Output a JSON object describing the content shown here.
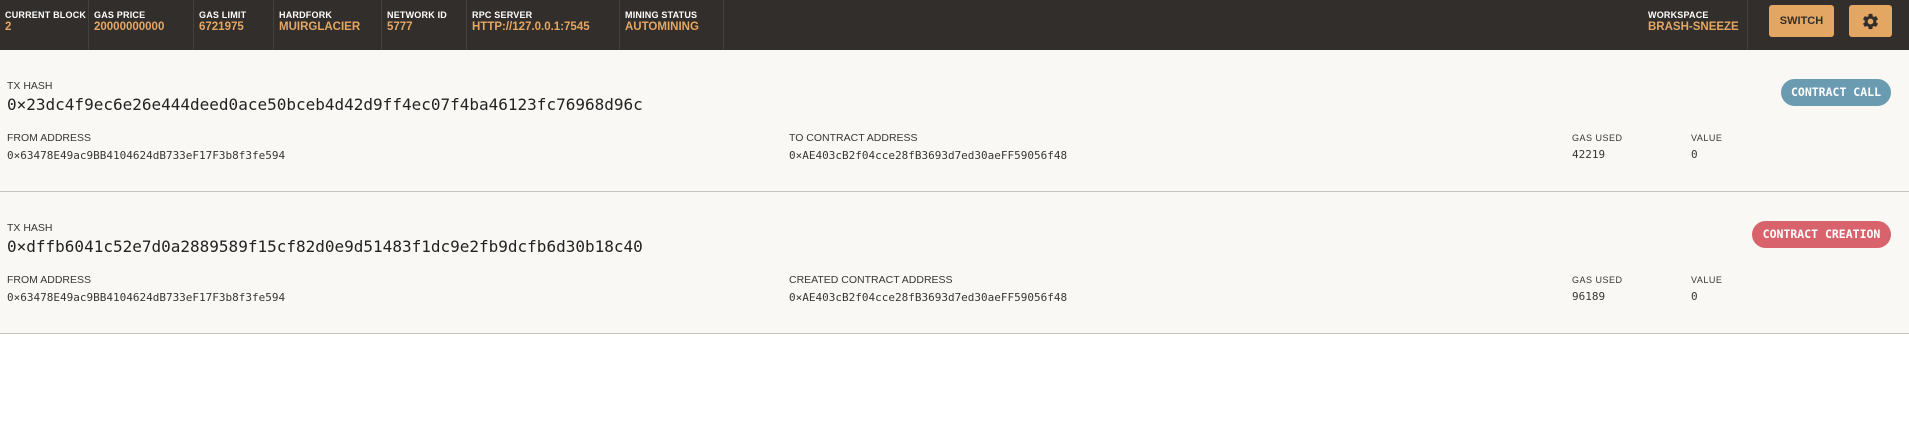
{
  "topbar": {
    "current_block": {
      "label": "CURRENT BLOCK",
      "value": "2"
    },
    "gas_price": {
      "label": "GAS PRICE",
      "value": "20000000000"
    },
    "gas_limit": {
      "label": "GAS LIMIT",
      "value": "6721975"
    },
    "hardfork": {
      "label": "HARDFORK",
      "value": "MUIRGLACIER"
    },
    "network_id": {
      "label": "NETWORK ID",
      "value": "5777"
    },
    "rpc_server": {
      "label": "RPC SERVER",
      "value": "HTTP://127.0.0.1:7545"
    },
    "mining_status": {
      "label": "MINING STATUS",
      "value": "AUTOMINING"
    },
    "workspace": {
      "label": "WORKSPACE",
      "value": "BRASH-SNEEZE"
    },
    "switch_label": "SWITCH",
    "settings_icon": "gear-icon"
  },
  "transactions": [
    {
      "hash_label": "TX HASH",
      "hash": "0×23dc4f9ec6e26e444deed0ace50bceb4d42d9ff4ec07f4ba46123fc76968d96c",
      "type": "CONTRACT CALL",
      "from_label": "FROM ADDRESS",
      "from": "0×63478E49ac9BB4104624dB733eF17F3b8f3fe594",
      "to_label": "TO CONTRACT ADDRESS",
      "to": "0×AE403cB2f04cce28fB3693d7ed30aeFF59056f48",
      "gas_used_label": "GAS USED",
      "gas_used": "42219",
      "value_label": "VALUE",
      "value": "0"
    },
    {
      "hash_label": "TX HASH",
      "hash": "0×dffb6041c52e7d0a2889589f15cf82d0e9d51483f1dc9e2fb9dcfb6d30b18c40",
      "type": "CONTRACT CREATION",
      "from_label": "FROM ADDRESS",
      "from": "0×63478E49ac9BB4104624dB733eF17F3b8f3fe594",
      "to_label": "CREATED CONTRACT ADDRESS",
      "to": "0×AE403cB2f04cce28fB3693d7ed30aeFF59056f48",
      "gas_used_label": "GAS USED",
      "gas_used": "96189",
      "value_label": "VALUE",
      "value": "0"
    }
  ],
  "colors": {
    "topbar_bg": "#322e2b",
    "accent": "#e4a663",
    "contract_call": "#6a9bb0",
    "contract_creation": "#d9636c",
    "row_bg": "#f9f8f4"
  }
}
